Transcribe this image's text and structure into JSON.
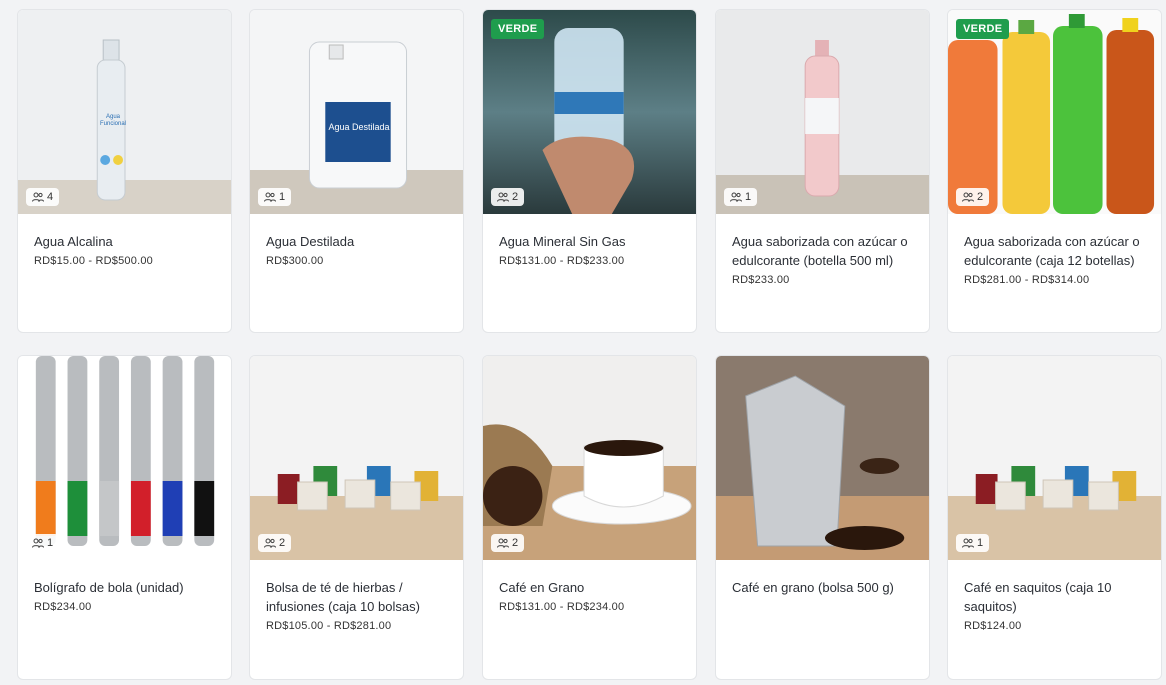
{
  "products": [
    {
      "name": "Agua Alcalina",
      "price": "RD$15.00 - RD$500.00",
      "count": "4",
      "badge": ""
    },
    {
      "name": "Agua Destilada",
      "price": "RD$300.00",
      "count": "1",
      "badge": ""
    },
    {
      "name": "Agua Mineral Sin Gas",
      "price": "RD$131.00 - RD$233.00",
      "count": "2",
      "badge": "VERDE"
    },
    {
      "name": "Agua saborizada con azúcar o edulcorante (botella 500 ml)",
      "price": "RD$233.00",
      "count": "1",
      "badge": ""
    },
    {
      "name": "Agua saborizada con azúcar o edulcorante (caja 12 botellas)",
      "price": "RD$281.00 - RD$314.00",
      "count": "2",
      "badge": "VERDE"
    },
    {
      "name": "Bolígrafo de bola (unidad)",
      "price": "RD$234.00",
      "count": "1",
      "badge": ""
    },
    {
      "name": "Bolsa de té de hierbas / infusiones (caja 10 bolsas)",
      "price": "RD$105.00 - RD$281.00",
      "count": "2",
      "badge": ""
    },
    {
      "name": "Café en Grano",
      "price": "RD$131.00 - RD$234.00",
      "count": "2",
      "badge": ""
    },
    {
      "name": "Café en grano (bolsa 500 g)",
      "price": "",
      "count": "",
      "badge": ""
    },
    {
      "name": "Café en saquitos (caja 10 saquitos)",
      "price": "RD$124.00",
      "count": "1",
      "badge": ""
    }
  ],
  "images": {
    "bottle_label": "Agua Funcional",
    "jug_label": "Agua Destilada"
  },
  "colors": {
    "badge": "#1f9d4d",
    "card_border": "#e3e5e8",
    "background": "#f2f3f5"
  },
  "icons": {
    "count": "users-icon"
  }
}
